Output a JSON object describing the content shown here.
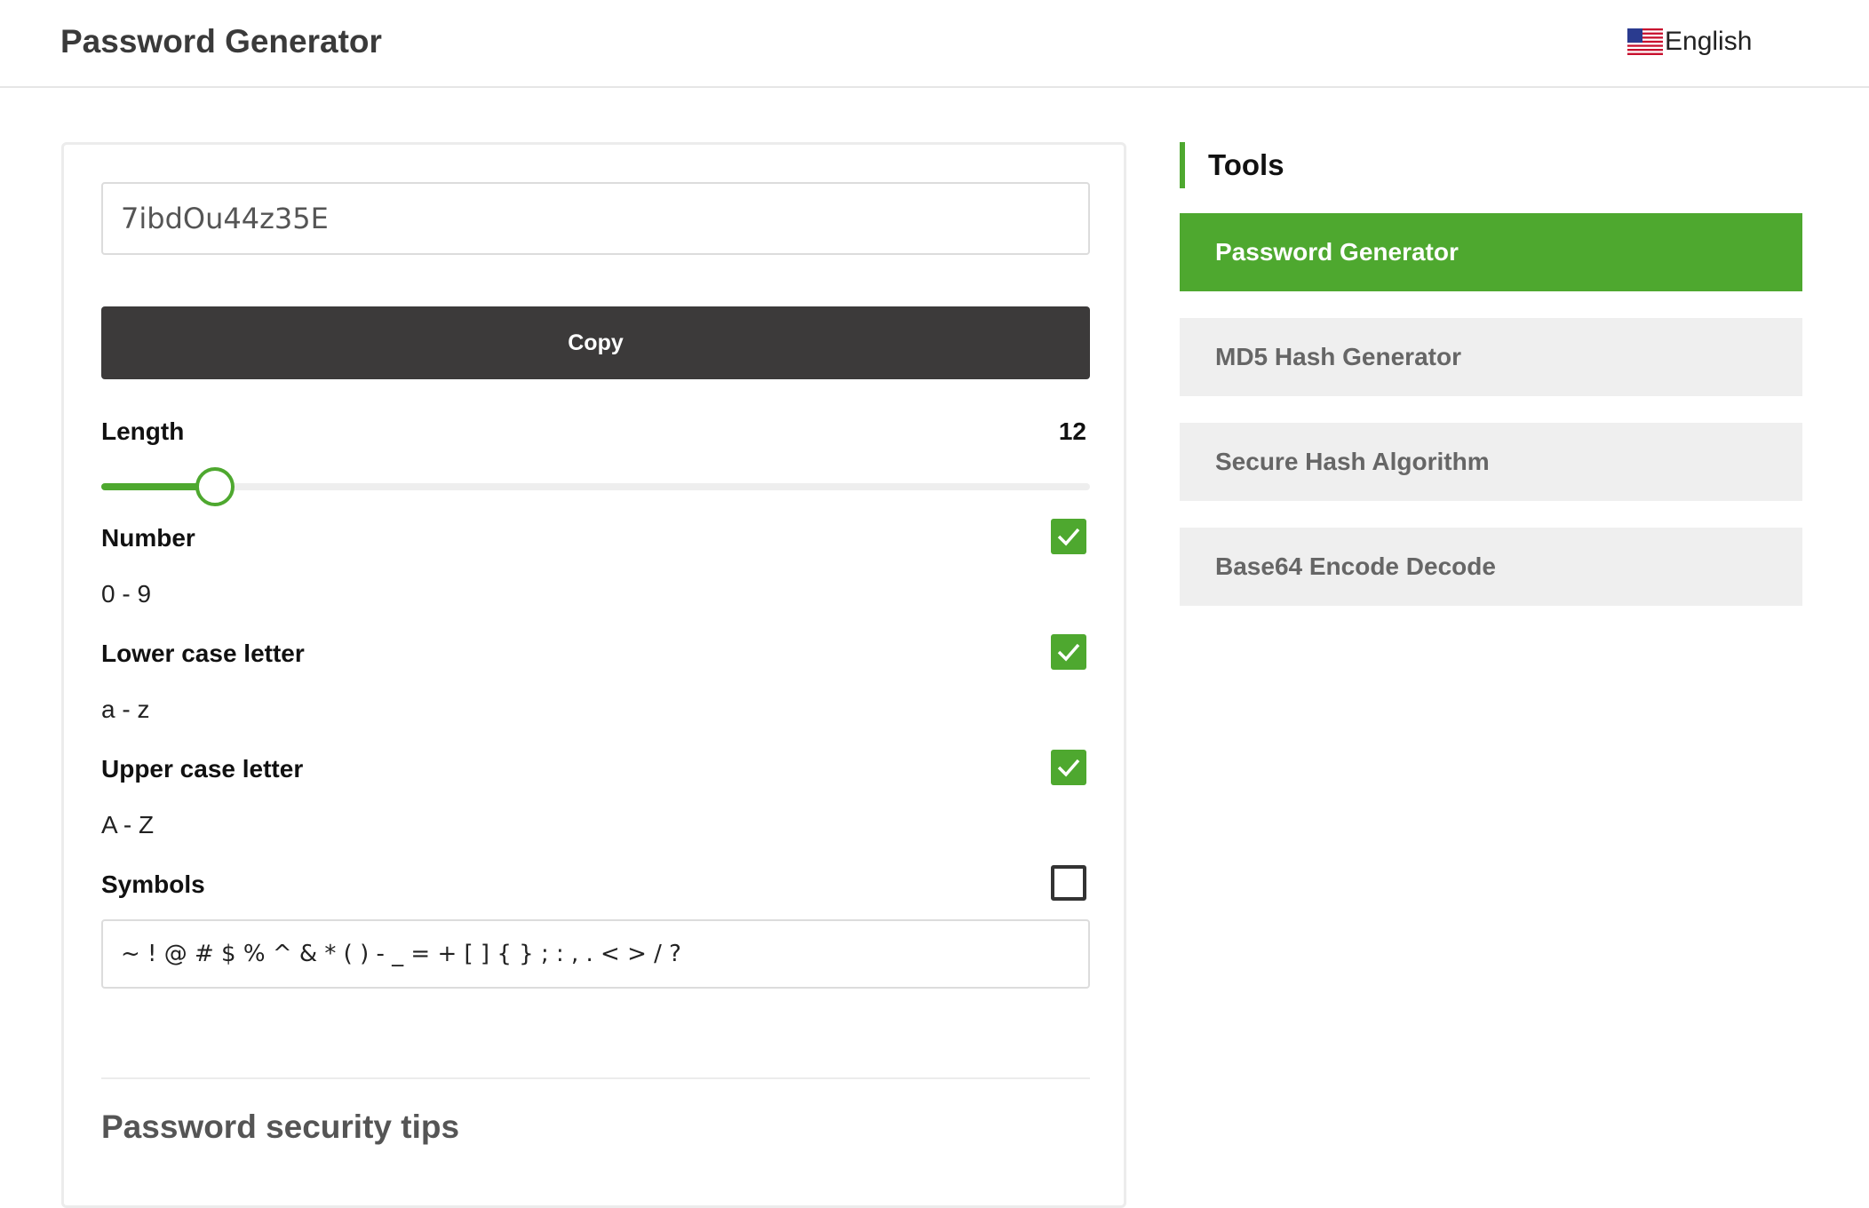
{
  "header": {
    "title": "Password Generator",
    "language": "English",
    "flag_icon": "us-flag-icon"
  },
  "generator": {
    "password": "7ibdOu44z35E",
    "copy_label": "Copy",
    "length": {
      "label": "Length",
      "value": "12",
      "slider_fraction": 0.115
    },
    "options": [
      {
        "label": "Number",
        "range": "0 - 9",
        "checked": true
      },
      {
        "label": "Lower case letter",
        "range": "a - z",
        "checked": true
      },
      {
        "label": "Upper case letter",
        "range": "A - Z",
        "checked": true
      },
      {
        "label": "Symbols",
        "range": "~ ! @ # $ % ^ & * ( ) - _ = + [ ] { } ; : , . < > / ?",
        "checked": false
      }
    ],
    "tips_title": "Password security tips"
  },
  "sidebar": {
    "heading": "Tools",
    "items": [
      {
        "label": "Password Generator",
        "active": true
      },
      {
        "label": "MD5 Hash Generator",
        "active": false
      },
      {
        "label": "Secure Hash Algorithm",
        "active": false
      },
      {
        "label": "Base64 Encode Decode",
        "active": false
      }
    ]
  },
  "colors": {
    "accent": "#4ea82f",
    "dark_button": "#3c3a3a",
    "inactive_tool_bg": "#efefef"
  }
}
